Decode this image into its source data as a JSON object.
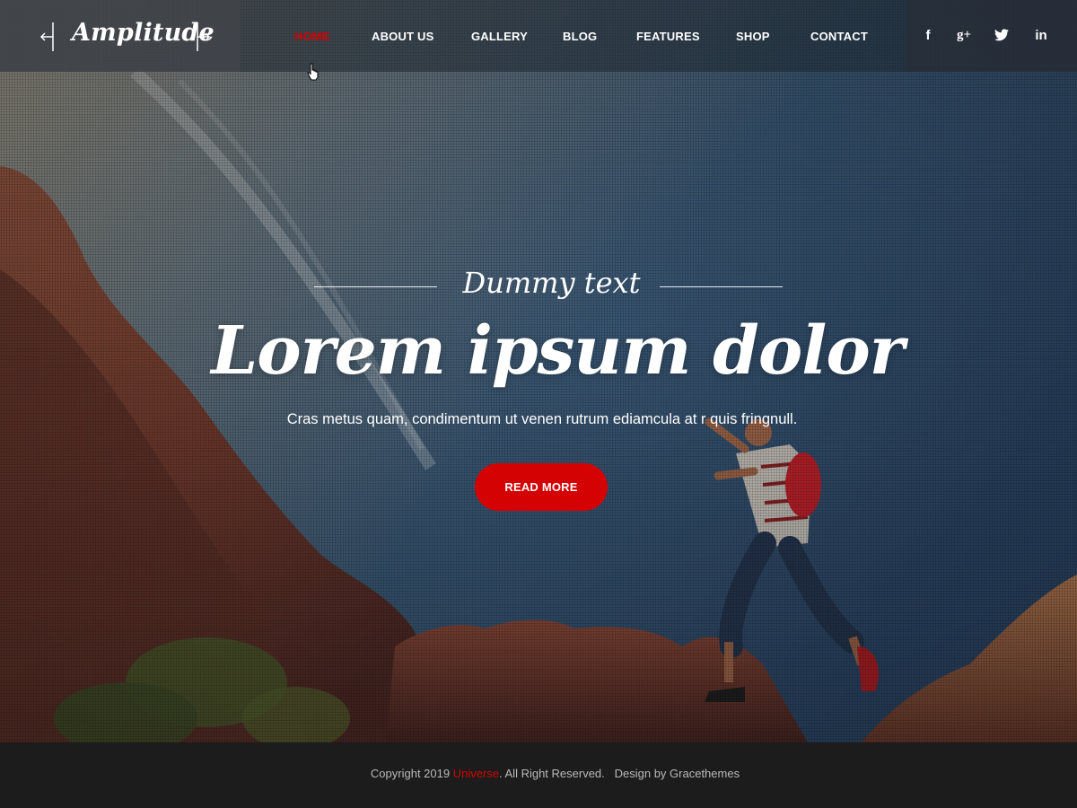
{
  "header": {
    "logo": "Amplitude",
    "nav": [
      {
        "label": "HOME",
        "active": true
      },
      {
        "label": "ABOUT US",
        "active": false
      },
      {
        "label": "GALLERY",
        "active": false
      },
      {
        "label": "BLOG",
        "active": false
      },
      {
        "label": "FEATURES",
        "active": false
      },
      {
        "label": "SHOP",
        "active": false
      },
      {
        "label": "CONTACT",
        "active": false
      }
    ],
    "social": [
      {
        "icon": "facebook-icon",
        "glyph": "f"
      },
      {
        "icon": "google-plus-icon",
        "glyph": "g+"
      },
      {
        "icon": "twitter-icon",
        "glyph": "t"
      },
      {
        "icon": "linkedin-icon",
        "glyph": "in"
      }
    ]
  },
  "hero": {
    "subheading": "Dummy text",
    "heading": "Lorem ipsum dolor",
    "description": "Cras metus quam, condimentum ut venen rutrum ediamcula at r quis fringnull.",
    "button_label": "READ MORE"
  },
  "footer": {
    "copyright_prefix": "Copyright 2019 ",
    "brand": "Universe",
    "copyright_suffix": ". All Right Reserved.",
    "credit": "Design by Gracethemes"
  },
  "colors": {
    "accent": "#d40000",
    "footer_bg": "#1c1c1c"
  }
}
